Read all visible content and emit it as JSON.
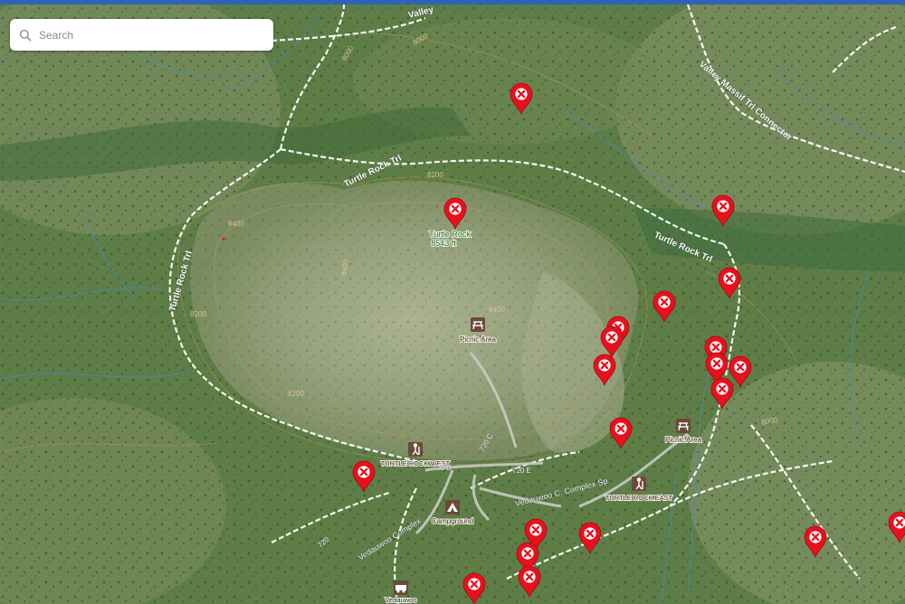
{
  "search": {
    "placeholder": "Search",
    "value": ""
  },
  "icons": {
    "search": "search-icon",
    "marker": "x-marker-icon",
    "picnic": "picnic-table-icon",
    "hiker": "hiker-icon",
    "tent": "tent-icon",
    "rv": "rv-icon"
  },
  "colors": {
    "topbar": "#2f63b8",
    "marker": "#e8101d",
    "trail": "#ffffff"
  },
  "trail_labels": {
    "valley_top": "Valley",
    "valley_massif": "Valley Massif Trl Connector",
    "turtle_rock_trl_n": "Turtle Rock Trl",
    "turtle_rock_trl_e": "Turtle Rock Trl",
    "turtle_rock_trl_w": "Turtle Rock Trl",
    "complex_sp": "Vedauwoo C. Complex Sp",
    "complex_sw": "Vedauwoo Complex"
  },
  "contours": {
    "c8000": "8000",
    "c8200": "8200",
    "c8400a": "8400",
    "c8400b": "8400",
    "c8400c": "8400",
    "c8200b": "8200",
    "c8200c": "8200",
    "c8000b": "8000",
    "c8000c": "8000"
  },
  "peak": {
    "name": "Turtle Rock",
    "elev": "8543 ft"
  },
  "pois": {
    "picnic1": "Picnic Area",
    "picnic2": "Picnic Area",
    "trailhead_west": "TURTLE ROCK WEST",
    "trailhead_east": "TURTLE ROCK EAST",
    "campground": "Campground",
    "rv": "Vedauwoo",
    "road_720e": "720 E",
    "road_720d": "720 D",
    "road_720c": "720 C",
    "road_720": "720"
  }
}
